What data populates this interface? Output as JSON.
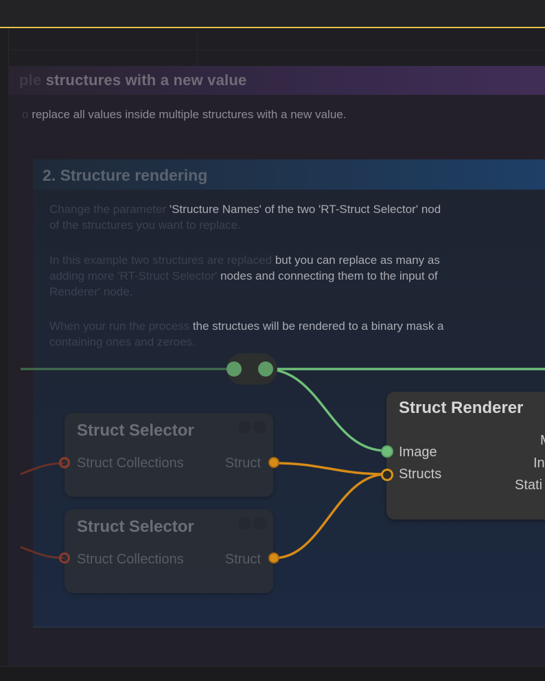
{
  "group1": {
    "title_prefix": "ple",
    "title_rest": " structures with a new value",
    "desc_prefix": "o",
    "desc_rest": " replace all values inside multiple structures with a new value."
  },
  "group2": {
    "title": "2. Structure rendering",
    "para1": [
      {
        "a": "Change the parameter ",
        "b": "'Structure Names' of the two 'RT-Struct Selector' nod"
      },
      {
        "a": "of the structures you want to replace.",
        "b": ""
      }
    ],
    "para2": [
      {
        "a": "In this example two structures are replaced ",
        "b": "but you can replace as many as"
      },
      {
        "a": "adding more 'RT-Struct Selector' ",
        "b": "nodes and connecting them to the input of"
      },
      {
        "a": "Renderer' node.",
        "b": ""
      }
    ],
    "para3": [
      {
        "a": "When your run the process ",
        "b": "the structues will be rendered to a binary mask a"
      },
      {
        "a": "containing ones and zeroes.",
        "b": ""
      }
    ]
  },
  "nodes": {
    "selector_a": {
      "title": "Struct Selector",
      "input": "Struct Collections",
      "output": "Struct"
    },
    "selector_b": {
      "title": "Struct Selector",
      "input": "Struct Collections",
      "output": "Struct"
    },
    "renderer": {
      "title": "Struct Renderer",
      "inputs": [
        "Image",
        "Structs"
      ],
      "outputs_partial": [
        "M",
        "In",
        "Stati"
      ]
    }
  },
  "colors": {
    "accent": "#e5c24a",
    "image_link": "#6fbf78",
    "struct_link": "#d78b17",
    "collection_link": "#8a3a2b"
  }
}
